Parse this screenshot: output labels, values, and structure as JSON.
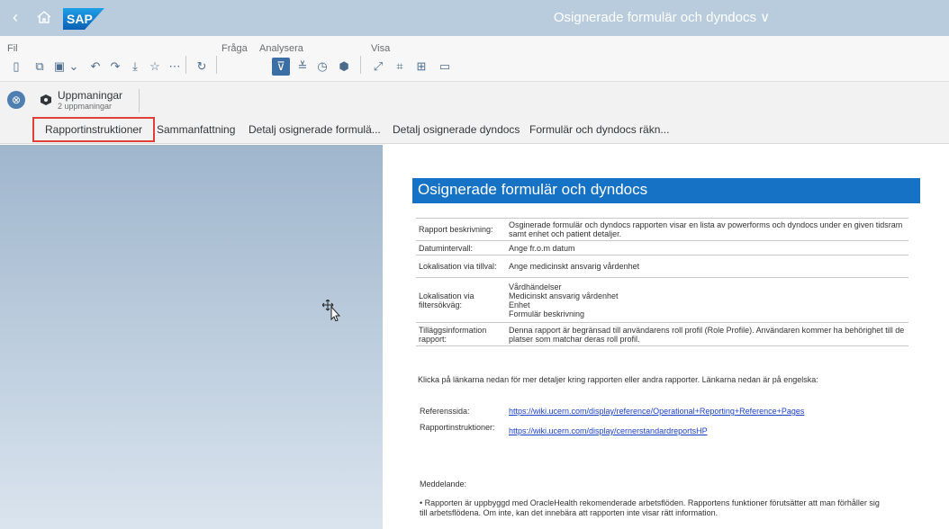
{
  "shell": {
    "back_glyph": "‹",
    "home_icon": "home-icon",
    "logo_text": "SAP",
    "title": "Osignerade formulär och dyndocs ∨"
  },
  "menu": {
    "fil": "Fil",
    "fraga": "Fråga",
    "analysera": "Analysera",
    "visa": "Visa"
  },
  "prompts": {
    "title": "Uppmaningar",
    "subtitle": "2 uppmaningar"
  },
  "tabs": [
    {
      "label": "Rapportinstruktioner"
    },
    {
      "label": "Sammanfattning"
    },
    {
      "label": "Detalj osignerade formulä..."
    },
    {
      "label": "Detalj osignerade dyndocs"
    },
    {
      "label": "Formulär och dyndocs räkn..."
    }
  ],
  "report": {
    "title": "Osignerade formulär och dyndocs",
    "rows": [
      {
        "key": "Rapport beskrivning:",
        "value": "Osginerade formulär och dyndocs rapporten visar en lista av powerforms och dyndocs under en given tidsram samt enhet och patient detaljer."
      },
      {
        "key": "Datumintervall:",
        "value": "Ange fr.o.m datum"
      },
      {
        "key": "Lokalisation via tillval:",
        "value": "Ange medicinskt ansvarig vårdenhet"
      },
      {
        "key": "Lokalisation via filtersökväg:",
        "value_lines": [
          "Vårdhändelser",
          "Medicinskt ansvarig vårdenhet",
          "Enhet",
          "Formulär beskrivning"
        ]
      },
      {
        "key": "Tilläggsinformation rapport:",
        "value": "Denna rapport är begränsad till användarens roll profil (Role Profile). Användaren kommer ha behörighet till de platser som matchar deras roll profil."
      }
    ],
    "links_intro": "Klicka på länkarna nedan för mer detaljer kring rapporten eller andra rapporter. Länkarna nedan är på engelska:",
    "ref_label": "Referenssida:",
    "ref_url": "https://wiki.ucern.com/display/reference/Operational+Reporting+Reference+Pages",
    "instr_label": "Rapportinstruktioner:",
    "instr_url": "https://wiki.ucern.com/display/cernerstandardreportsHP",
    "message_heading": "Meddelande:",
    "message_text": "• Rapporten är uppbyggd med OracleHealth rekomenderade arbetsflöden. Rapportens funktioner förutsätter att man förhåller sig till arbetsflödena. Om inte, kan det innebära att rapporten inte visar rätt information."
  },
  "colors": {
    "shell_bg": "#b9ccdd",
    "report_banner": "#1672c4",
    "active_tab_outline": "#e0403a",
    "link": "#1a3fc8"
  }
}
